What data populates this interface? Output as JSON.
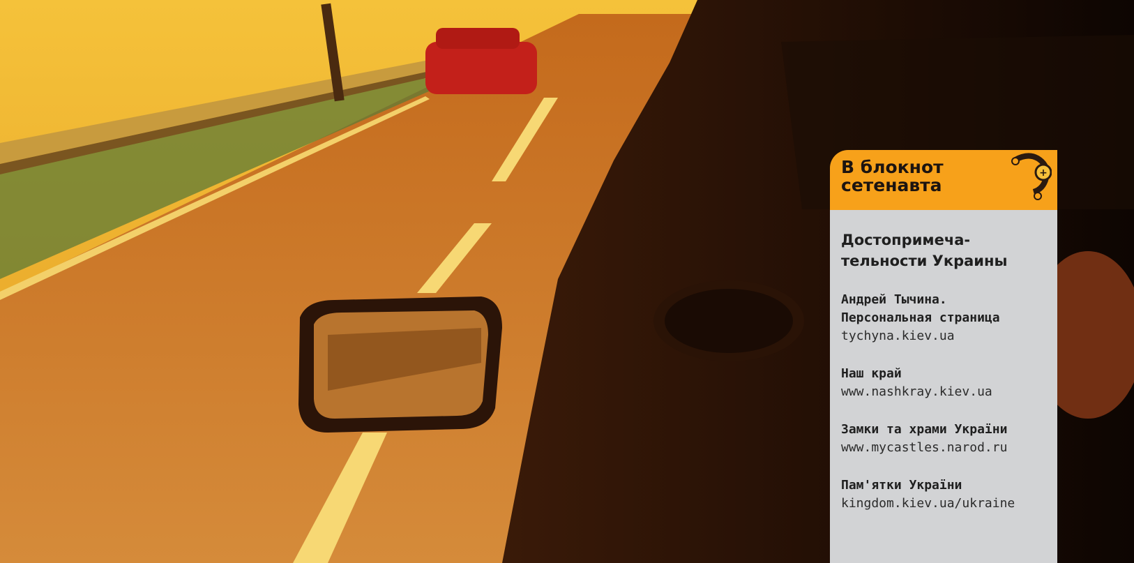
{
  "sidebar": {
    "title_line1": "В блокнот",
    "title_line2": "сетенавта",
    "section_line1": "Достопримеча-",
    "section_line2": "тельности Украины",
    "entries": [
      {
        "title_line1": "Андрей Тычина.",
        "title_line2": "Персональная страница",
        "url": "tychyna.kiev.ua"
      },
      {
        "title_line1": "Наш край",
        "title_line2": "",
        "url": "www.nashkray.kiev.ua"
      },
      {
        "title_line1": "Замки та храми України",
        "title_line2": "",
        "url": "www.mycastles.narod.ru"
      },
      {
        "title_line1": "Пам'ятки України",
        "title_line2": "",
        "url": "kingdom.kiev.ua/ukraine"
      }
    ]
  },
  "colors": {
    "header_orange": "#f7a11a",
    "sidebar_gray": "#d2d3d5",
    "photo_orange": "#e8902a"
  }
}
